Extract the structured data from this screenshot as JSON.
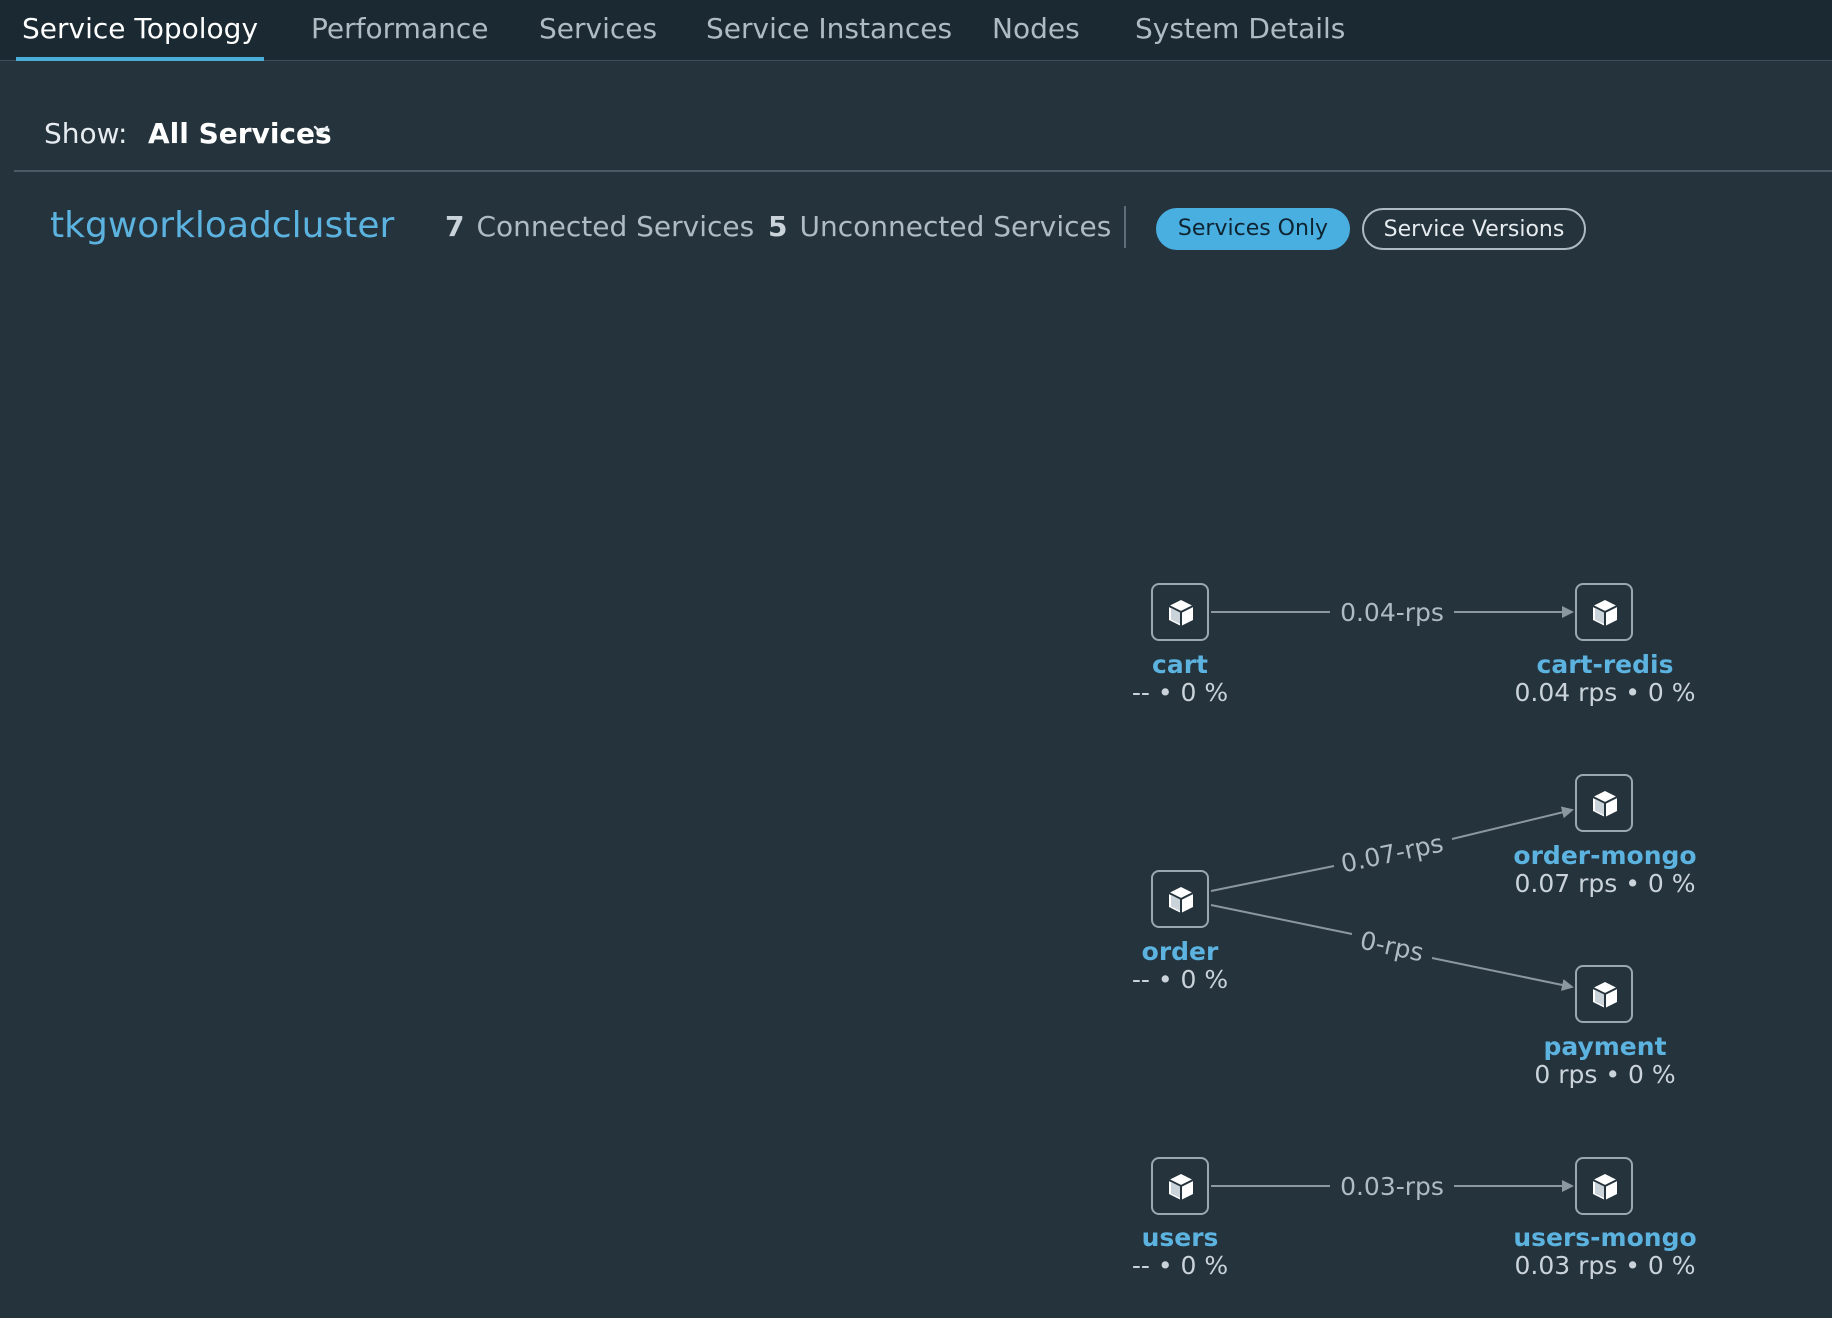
{
  "tabs": [
    {
      "label": "Service Topology",
      "active": true
    },
    {
      "label": "Performance",
      "active": false
    },
    {
      "label": "Services",
      "active": false
    },
    {
      "label": "Service Instances",
      "active": false
    },
    {
      "label": "Nodes",
      "active": false
    },
    {
      "label": "System Details",
      "active": false
    }
  ],
  "filter": {
    "label": "Show:",
    "value": "All Services",
    "icon": "chevron-down-icon"
  },
  "cluster": {
    "name": "tkgworkloadcluster",
    "connected_count": "7",
    "connected_label": "Connected Services",
    "unconnected_count": "5",
    "unconnected_label": "Unconnected Services"
  },
  "view_toggle": {
    "services_only": "Services Only",
    "service_versions": "Service Versions",
    "selected": "services_only"
  },
  "topology": {
    "nodes": {
      "cart": {
        "name": "cart",
        "stats": "-- • 0 %",
        "icon": "cube-icon"
      },
      "cart_redis": {
        "name": "cart-redis",
        "stats": "0.04 rps • 0 %",
        "icon": "cube-icon"
      },
      "order": {
        "name": "order",
        "stats": "-- • 0 %",
        "icon": "cube-icon"
      },
      "order_mongo": {
        "name": "order-mongo",
        "stats": "0.07 rps • 0 %",
        "icon": "cube-icon"
      },
      "payment": {
        "name": "payment",
        "stats": "0 rps • 0 %",
        "icon": "cube-icon"
      },
      "users": {
        "name": "users",
        "stats": "-- • 0 %",
        "icon": "cube-icon"
      },
      "users_mongo": {
        "name": "users-mongo",
        "stats": "0.03 rps • 0 %",
        "icon": "cube-icon"
      }
    },
    "edges": [
      {
        "from": "cart",
        "to": "cart-redis",
        "label": "0.04-rps"
      },
      {
        "from": "order",
        "to": "order-mongo",
        "label": "0.07-rps"
      },
      {
        "from": "order",
        "to": "payment",
        "label": "0-rps"
      },
      {
        "from": "users",
        "to": "users-mongo",
        "label": "0.03-rps"
      }
    ]
  },
  "colors": {
    "background": "#25333d",
    "accent": "#5cb3e0",
    "edge": "#8c989f"
  }
}
